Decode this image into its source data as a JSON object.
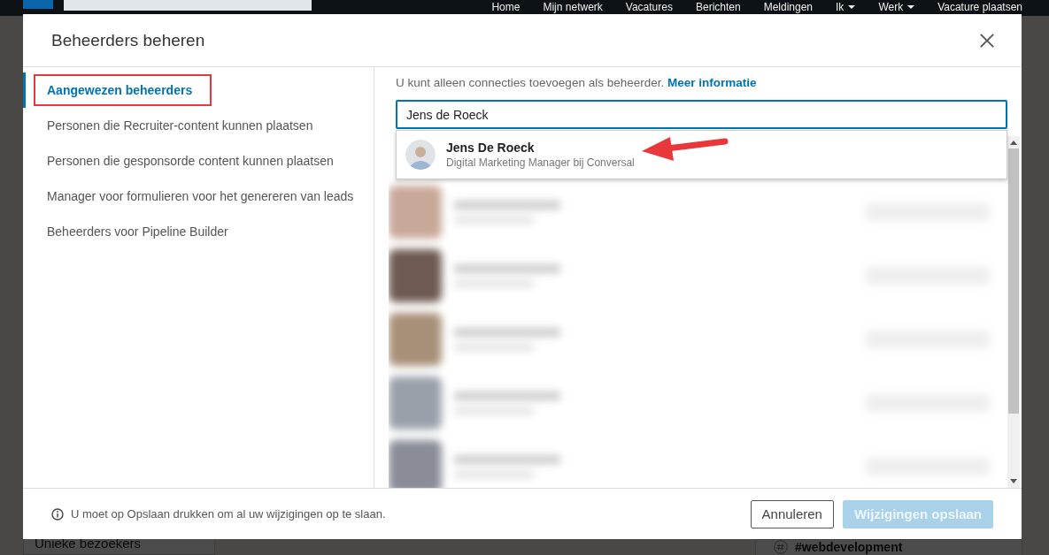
{
  "navbar": {
    "items": [
      {
        "label": "Home",
        "caret": false
      },
      {
        "label": "Mijn netwerk",
        "caret": false
      },
      {
        "label": "Vacatures",
        "caret": false
      },
      {
        "label": "Berichten",
        "caret": false
      },
      {
        "label": "Meldingen",
        "caret": false
      },
      {
        "label": "Ik",
        "caret": true
      },
      {
        "label": "Werk",
        "caret": true
      },
      {
        "label": "Vacature plaatsen",
        "caret": false
      }
    ]
  },
  "background": {
    "left_text": "Unieke bezoekers",
    "right_text": "#webdevelopment"
  },
  "dialog": {
    "title": "Beheerders beheren",
    "sidebar": {
      "items": [
        {
          "label": "Aangewezen beheerders",
          "selected": true,
          "highlighted": true
        },
        {
          "label": "Personen die Recruiter-content kunnen plaatsen",
          "selected": false,
          "highlighted": false
        },
        {
          "label": "Personen die gesponsorde content kunnen plaatsen",
          "selected": false,
          "highlighted": false
        },
        {
          "label": "Manager voor formulieren voor het genereren van leads",
          "selected": false,
          "highlighted": false
        },
        {
          "label": "Beheerders voor Pipeline Builder",
          "selected": false,
          "highlighted": false
        }
      ]
    },
    "info": {
      "text": "U kunt alleen connecties toevoegen als beheerder.",
      "link": "Meer informatie"
    },
    "search": {
      "value": "Jens de Roeck"
    },
    "suggestions": [
      {
        "name": "Jens De Roeck",
        "headline": "Digital Marketing Manager bij Conversal",
        "arrow": true
      }
    ],
    "results": [
      {
        "kind": "blurred"
      },
      {
        "kind": "blurred"
      },
      {
        "kind": "blurred"
      },
      {
        "kind": "blurred"
      },
      {
        "kind": "blurred"
      }
    ],
    "footer": {
      "note": "U moet op Opslaan drukken om al uw wijzigingen op te slaan.",
      "buttons": [
        {
          "label": "Annuleren",
          "kind": "secondary",
          "disabled": false
        },
        {
          "label": "Wijzigingen opslaan",
          "kind": "primary",
          "disabled": true
        }
      ]
    }
  }
}
